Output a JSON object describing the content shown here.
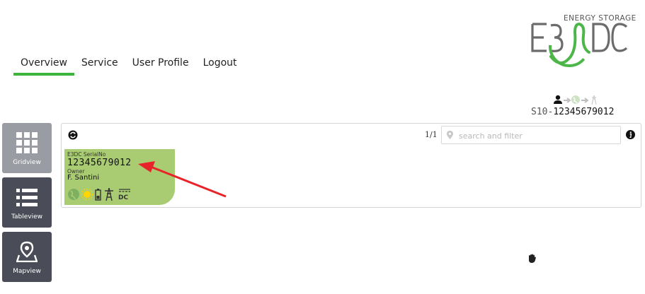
{
  "brand": {
    "tagline": "ENERGY STORAGE",
    "logo_text": "E3DC",
    "accent_color": "#3db53d"
  },
  "nav": {
    "items": [
      {
        "label": "Overview",
        "active": true
      },
      {
        "label": "Service"
      },
      {
        "label": "User Profile"
      },
      {
        "label": "Logout"
      }
    ]
  },
  "status": {
    "icons": [
      "user-icon",
      "arrow-right-icon",
      "globe-icon",
      "arrow-right-icon",
      "tower-icon"
    ],
    "device_prefix": "S10-",
    "device_serial": "12345679012"
  },
  "sidebar": {
    "items": [
      {
        "label": "Gridview",
        "icon": "grid-icon",
        "active": true
      },
      {
        "label": "Tableview",
        "icon": "list-icon"
      },
      {
        "label": "Mapview",
        "icon": "map-pin-icon"
      }
    ]
  },
  "toolbar": {
    "pager": "1/1",
    "search_placeholder": "search and filter",
    "search_value": ""
  },
  "card": {
    "brand_label": "E3DC",
    "serial_label": "SerialNo",
    "serial": "12345679012",
    "owner_label": "Owner",
    "owner": "F. Santini",
    "dc_label": "DC",
    "icons": [
      "globe-icon",
      "sun-icon",
      "battery-icon",
      "grid-tower-icon",
      "dc-icon"
    ],
    "color": "#a9cc72"
  },
  "annotation": {
    "arrow_color": "#e8242a"
  }
}
